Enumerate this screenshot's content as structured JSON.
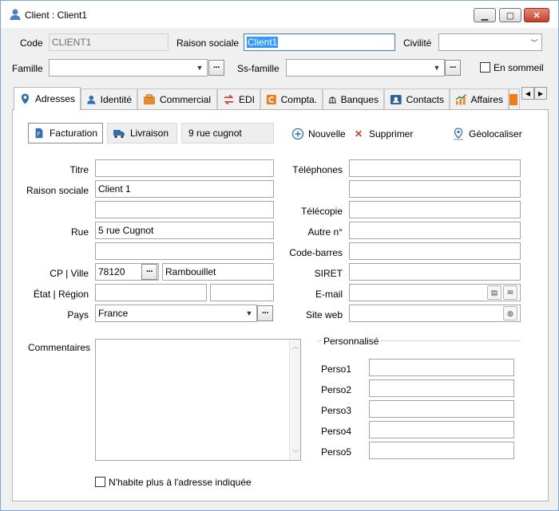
{
  "window": {
    "title": "Client : Client1"
  },
  "header": {
    "code_label": "Code",
    "code_value": "CLIENT1",
    "raison_label": "Raison sociale",
    "raison_value": "Client1",
    "civilite_label": "Civilité",
    "civilite_value": "",
    "famille_label": "Famille",
    "famille_value": "",
    "ssfamille_label": "Ss-famille",
    "ssfamille_value": "",
    "sommeil_label": "En sommeil"
  },
  "tabs": [
    {
      "label": "Adresses",
      "icon": "map-pin-icon"
    },
    {
      "label": "Identité",
      "icon": "person-icon"
    },
    {
      "label": "Commercial",
      "icon": "briefcase-icon"
    },
    {
      "label": "EDI",
      "icon": "exchange-arrows-icon"
    },
    {
      "label": "Compta.",
      "icon": "accounting-c-icon"
    },
    {
      "label": "Banques",
      "icon": "bank-icon"
    },
    {
      "label": "Contacts",
      "icon": "contact-card-icon"
    },
    {
      "label": "Affaires",
      "icon": "chart-icon"
    }
  ],
  "subtabs": {
    "facturation": "Facturation",
    "livraison": "Livraison",
    "address_extra": "9 rue cugnot"
  },
  "toolbar": {
    "nouvelle": "Nouvelle",
    "supprimer": "Supprimer",
    "geolocaliser": "Géolocaliser"
  },
  "address": {
    "titre_label": "Titre",
    "titre_value": "",
    "raison_label": "Raison sociale",
    "raison_value": "Client 1",
    "raison2_value": "",
    "rue_label": "Rue",
    "rue_value": "5 rue Cugnot",
    "rue2_value": "",
    "cpville_label": "CP | Ville",
    "cp_value": "78120",
    "ville_value": "Rambouillet",
    "etat_label": "État | Région",
    "etat_value": "",
    "region_value": "",
    "pays_label": "Pays",
    "pays_value": "France"
  },
  "contact": {
    "telephones_label": "Téléphones",
    "tel1": "",
    "tel2": "",
    "telecopie_label": "Télécopie",
    "telecopie": "",
    "autre_label": "Autre n°",
    "autre": "",
    "codebarres_label": "Code-barres",
    "codebarres": "",
    "siret_label": "SIRET",
    "siret": "",
    "email_label": "E-mail",
    "email": "",
    "site_label": "Site web",
    "site": ""
  },
  "commentaires_label": "Commentaires",
  "personnalise": {
    "title": "Personnalisé",
    "labels": [
      "Perso1",
      "Perso2",
      "Perso3",
      "Perso4",
      "Perso5"
    ],
    "values": [
      "",
      "",
      "",
      "",
      ""
    ]
  },
  "nhabite_label": "N'habite plus à l'adresse indiquée",
  "colors": {
    "accent": "#3c7fd1",
    "selection": "#3399ff"
  }
}
